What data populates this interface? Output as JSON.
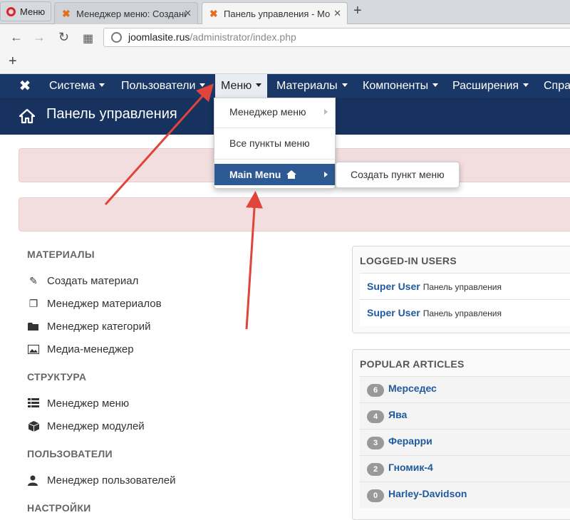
{
  "browser": {
    "menu_button": "Меню",
    "tabs": [
      {
        "title": "Менеджер меню: Создани"
      },
      {
        "title": "Панель управления - Мо"
      }
    ],
    "new_tab": "+",
    "url_host": "joomlasite.rus",
    "url_path": "/administrator/index.php",
    "bookmark_add": "+"
  },
  "navbar": {
    "items": [
      {
        "label": "Система"
      },
      {
        "label": "Пользователи"
      },
      {
        "label": "Меню"
      },
      {
        "label": "Материалы"
      },
      {
        "label": "Компоненты"
      },
      {
        "label": "Расширения"
      },
      {
        "label": "Спра"
      }
    ]
  },
  "page": {
    "title": "Панель управления"
  },
  "menu_dropdown": {
    "items": [
      {
        "label": "Менеджер меню"
      },
      {
        "label": "Все пункты меню"
      },
      {
        "label": "Main Menu"
      }
    ],
    "submenu": {
      "label": "Создать пункт меню"
    }
  },
  "sidebar": {
    "sections": [
      {
        "title": "МАТЕРИАЛЫ",
        "items": [
          "Создать материал",
          "Менеджер материалов",
          "Менеджер категорий",
          "Медиа-менеджер"
        ]
      },
      {
        "title": "СТРУКТУРА",
        "items": [
          "Менеджер меню",
          "Менеджер модулей"
        ]
      },
      {
        "title": "ПОЛЬЗОВАТЕЛИ",
        "items": [
          "Менеджер пользователей"
        ]
      },
      {
        "title": "НАСТРОЙКИ",
        "items": []
      }
    ]
  },
  "logged_in": {
    "title": "LOGGED-IN USERS",
    "rows": [
      {
        "user": "Super User",
        "where": "Панель управления"
      },
      {
        "user": "Super User",
        "where": "Панель управления"
      }
    ]
  },
  "popular": {
    "title": "POPULAR ARTICLES",
    "rows": [
      {
        "hits": "6",
        "title": "Мерседес"
      },
      {
        "hits": "4",
        "title": "Ява"
      },
      {
        "hits": "3",
        "title": "Ферарри"
      },
      {
        "hits": "2",
        "title": "Гномик-4"
      },
      {
        "hits": "0",
        "title": "Harley-Davidson"
      }
    ]
  },
  "colors": {
    "navbar": "#1a3867",
    "subheader": "#17325f",
    "highlight": "#2d5a92",
    "arrow": "#e0443a",
    "alert": "#f2dede"
  }
}
